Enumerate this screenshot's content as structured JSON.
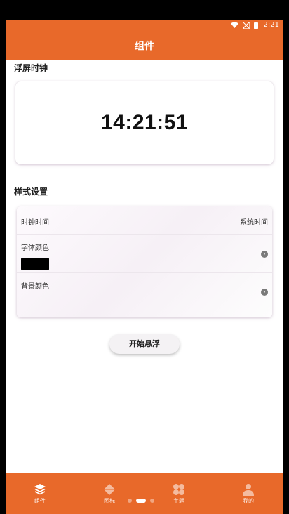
{
  "status_bar": {
    "time": "2:21"
  },
  "app_bar": {
    "title": "组件"
  },
  "floating_clock": {
    "section_title": "浮屏时钟",
    "time": "14:21:51"
  },
  "style_settings": {
    "section_title": "样式设置",
    "rows": [
      {
        "label": "时钟时间",
        "value": "系统时间"
      },
      {
        "label": "字体颜色",
        "color": "#000000"
      },
      {
        "label": "背景颜色"
      }
    ]
  },
  "start_button": {
    "label": "开始悬浮"
  },
  "bottom_nav": {
    "items": [
      {
        "label": "组件",
        "icon": "layers-icon",
        "active": true
      },
      {
        "label": "图标",
        "icon": "shapes-icon",
        "active": false
      },
      {
        "label": "主题",
        "icon": "petals-icon",
        "active": false
      },
      {
        "label": "我的",
        "icon": "person-icon",
        "active": false
      }
    ]
  },
  "colors": {
    "brand": "#E8692A",
    "background": "#FFFFFF"
  }
}
